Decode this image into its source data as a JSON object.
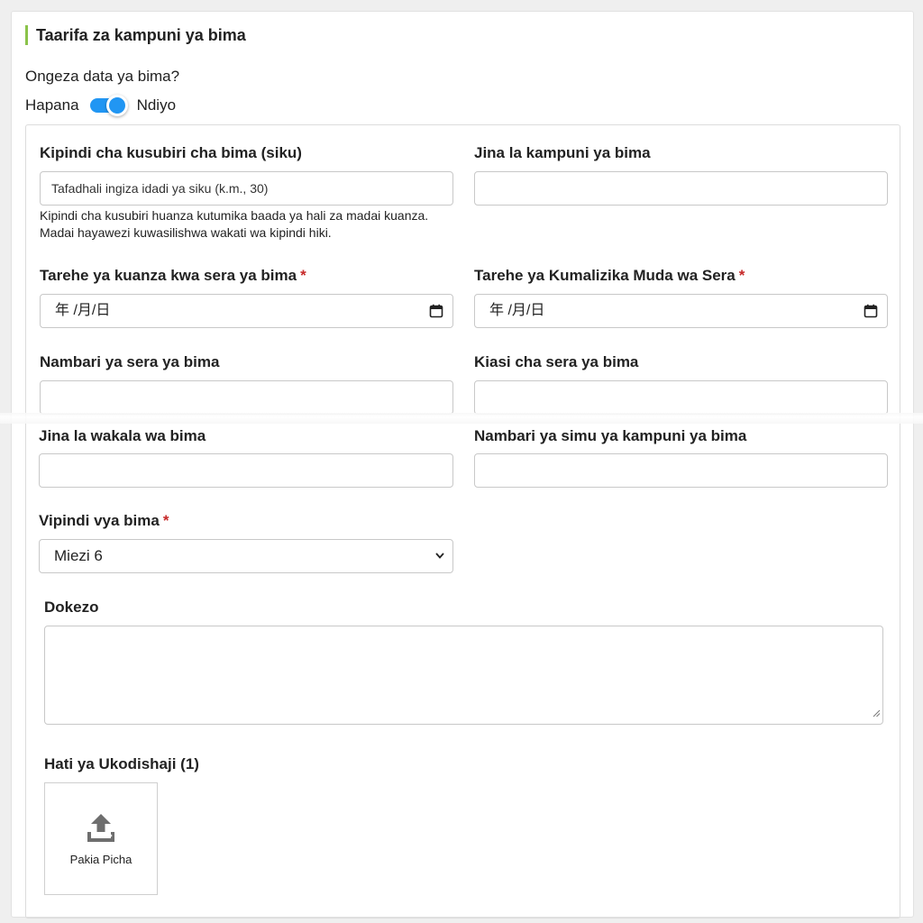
{
  "section": {
    "title": "Taarifa za kampuni ya bima"
  },
  "toggle": {
    "question": "Ongeza data ya bima?",
    "off_label": "Hapana",
    "on_label": "Ndiyo",
    "state": "on",
    "accent": "#2196f3"
  },
  "form": {
    "waiting_period": {
      "label": "Kipindi cha kusubiri cha bima (siku)",
      "placeholder": "Tafadhali ingiza idadi ya siku (k.m., 30)",
      "help_line1": "Kipindi cha kusubiri huanza kutumika baada ya hali za madai kuanza.",
      "help_line2": "Madai hayawezi kuwasilishwa wakati wa kipindi hiki."
    },
    "company_name": {
      "label": "Jina la kampuni ya bima",
      "value": ""
    },
    "start_date": {
      "label": "Tarehe ya kuanza kwa sera ya bima",
      "required": "*",
      "display": "年 /月/日"
    },
    "end_date": {
      "label": "Tarehe ya Kumalizika Muda wa Sera",
      "required": "*",
      "display": "年 /月/日"
    },
    "policy_number": {
      "label": "Nambari ya sera ya bima",
      "value": ""
    },
    "policy_amount": {
      "label": "Kiasi cha sera ya bima",
      "value": ""
    },
    "agent_name": {
      "label": "Jina la wakala wa bima",
      "value": ""
    },
    "company_phone": {
      "label": "Nambari ya simu ya kampuni ya bima",
      "value": ""
    },
    "periods": {
      "label": "Vipindi vya bima",
      "required": "*",
      "selected": "Miezi 6"
    },
    "note": {
      "label": "Dokezo",
      "value": ""
    },
    "lease_document": {
      "label": "Hati ya Ukodishaji (1)",
      "upload_label": "Pakia Picha"
    }
  },
  "colors": {
    "section_accent": "#8bc34a",
    "required": "#c62828"
  }
}
